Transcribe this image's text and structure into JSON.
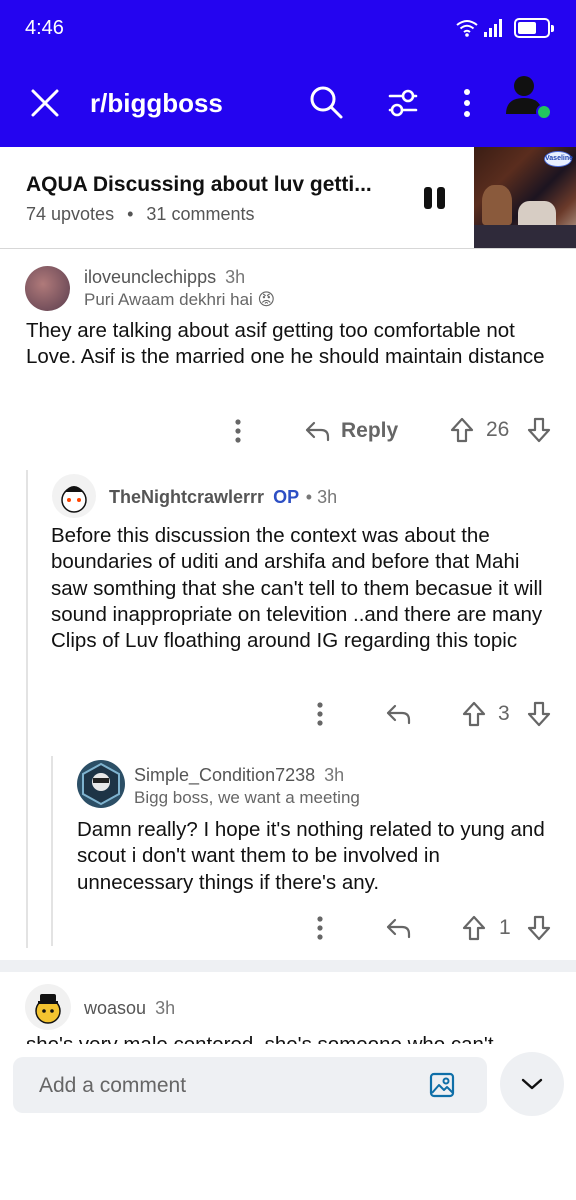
{
  "status": {
    "time": "4:46"
  },
  "header": {
    "title": "r/biggboss",
    "icons": [
      "close-icon",
      "search-icon",
      "filter-icon",
      "more-icon",
      "user-icon"
    ],
    "accent": "#2404f0"
  },
  "post": {
    "title": "AQUA Discussing about luv getti...",
    "upvotes": "74 upvotes",
    "separator": "•",
    "comments": "31 comments",
    "thumb_logo": "Vaseline"
  },
  "comments": [
    {
      "username": "iloveunclechipps",
      "time": "3h",
      "flair": "Puri Awaam dekhri hai 😡",
      "body": "They are talking about asif getting too comfortable not Love. Asif is the married one he should maintain distance",
      "reply_label": "Reply",
      "score": "26"
    },
    {
      "username": "TheNightcrawlerrr",
      "op": "OP",
      "time": "• 3h",
      "body": "Before this discussion the context was about the boundaries of uditi and arshifa and before that Mahi saw somthing that she can't tell to them becasue it will sound inappropriate on televition ..and there are many Clips of Luv floathing around IG regarding this topic",
      "score": "3"
    },
    {
      "username": "Simple_Condition7238",
      "time": "3h",
      "flair": "Bigg boss, we want a meeting",
      "body": "Damn really? I hope it's nothing related to yung and scout i don't want them to be involved in unnecessary things if there's any.",
      "score": "1"
    },
    {
      "username": "woasou",
      "time": "3h",
      "body_cut": "she's very male centered, she's someone who can't"
    }
  ],
  "composer": {
    "placeholder": "Add a comment"
  }
}
